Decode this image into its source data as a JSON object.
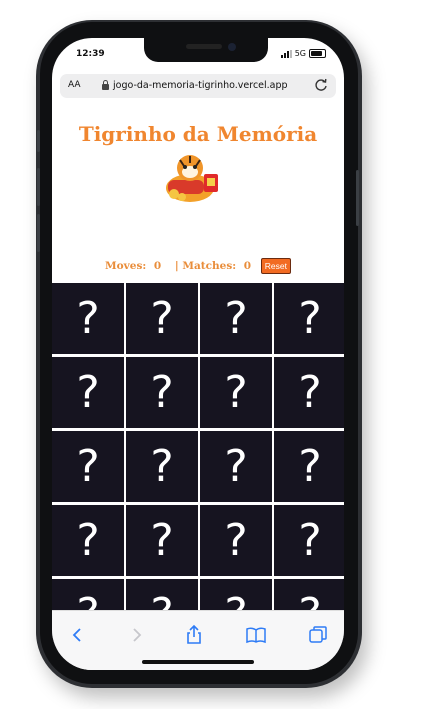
{
  "status_bar": {
    "time": "12:39",
    "network": "5G"
  },
  "browser": {
    "text_size_label": "AA",
    "url": "jogo-da-memoria-tigrinho.vercel.app"
  },
  "page": {
    "title": "Tigrinho da Memória",
    "moves_label": "Moves:",
    "moves_value": "0",
    "separator": "|",
    "matches_label": "Matches:",
    "matches_value": "0",
    "reset_label": "Reset",
    "cards": [
      "?",
      "?",
      "?",
      "?",
      "?",
      "?",
      "?",
      "?",
      "?",
      "?",
      "?",
      "?",
      "?",
      "?",
      "?",
      "?",
      "?",
      "?",
      "?",
      "?"
    ]
  },
  "toolbar": {
    "items": [
      "back-icon",
      "forward-icon",
      "share-icon",
      "bookmarks-icon",
      "tabs-icon"
    ]
  },
  "colors": {
    "title": "#f0862f",
    "stats": "#e98d3a",
    "reset_button": "#f26b22",
    "card_back": "#161420",
    "toolbar_icon": "#2f7cf6"
  }
}
